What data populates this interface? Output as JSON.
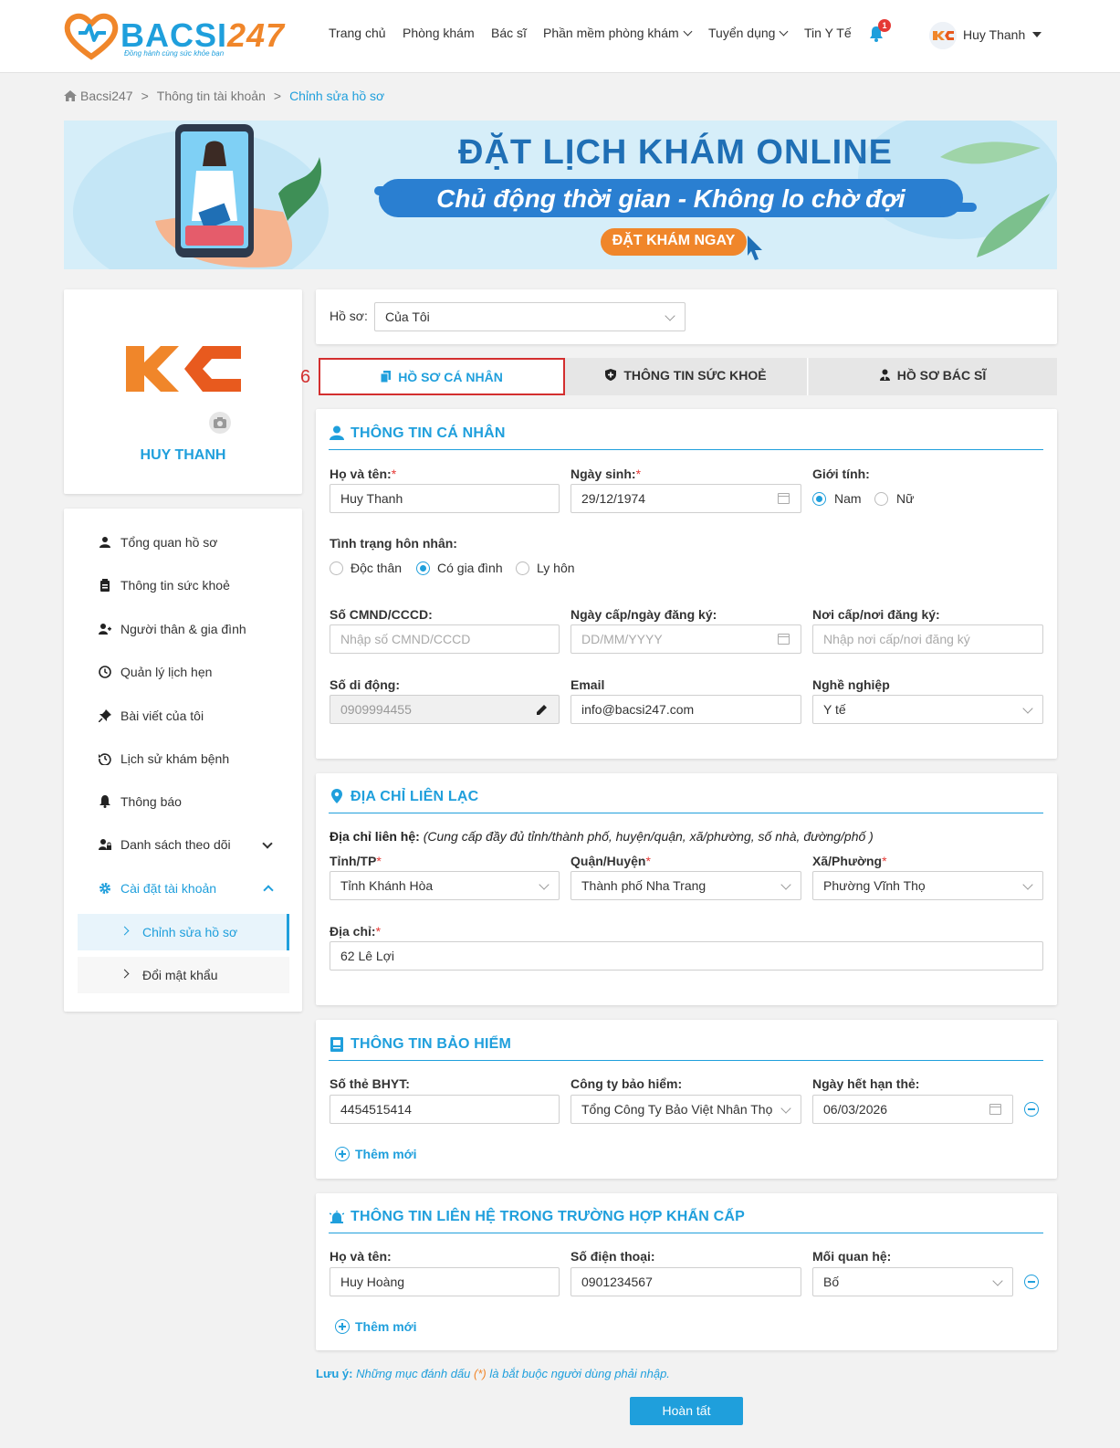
{
  "header": {
    "logo_text": "BACSI",
    "logo_num": "247",
    "logo_tagline": "Đồng hành cùng sức khỏe bạn",
    "nav": [
      "Trang chủ",
      "Phòng khám",
      "Bác sĩ",
      "Phần mềm phòng khám",
      "Tuyển dụng",
      "Tin Y Tế"
    ],
    "notification_count": "1",
    "user_name": "Huy Thanh"
  },
  "breadcrumb": [
    "Bacsi247",
    "Thông tin tài khoản",
    "Chỉnh sửa hồ sơ"
  ],
  "banner": {
    "title": "ĐẶT LỊCH KHÁM ONLINE",
    "subtitle": "Chủ động thời gian - Không lo chờ đợi",
    "cta": "ĐẶT KHÁM NGAY"
  },
  "profile": {
    "avatar_text": "KC",
    "name": "HUY THANH"
  },
  "sidebar": {
    "items": [
      "Tổng quan hồ sơ",
      "Thông tin sức khoẻ",
      "Người thân & gia đình",
      "Quản lý lịch hẹn",
      "Bài viết của tôi",
      "Lịch sử khám bệnh",
      "Thông báo",
      "Danh sách theo dõi",
      "Cài đặt tài khoản"
    ],
    "sub_items": [
      "Chỉnh sửa hồ sơ",
      "Đổi mật khẩu"
    ]
  },
  "profile_select": {
    "label": "Hồ sơ:",
    "value": "Của Tôi"
  },
  "annotation_number": "6",
  "tabs": [
    "HỒ SƠ CÁ NHÂN",
    "THÔNG TIN SỨC KHOẺ",
    "HỒ SƠ BÁC SĨ"
  ],
  "personal": {
    "title": "THÔNG TIN CÁ NHÂN",
    "name_label": "Họ và tên:",
    "name_value": "Huy Thanh",
    "dob_label": "Ngày sinh:",
    "dob_value": "29/12/1974",
    "gender_label": "Giới tính:",
    "gender_options": [
      "Nam",
      "Nữ"
    ],
    "marital_label": "Tình trạng hôn nhân:",
    "marital_options": [
      "Độc thân",
      "Có gia đình",
      "Ly hôn"
    ],
    "id_label": "Số CMND/CCCD:",
    "id_placeholder": "Nhập số CMND/CCCD",
    "issue_date_label": "Ngày cấp/ngày đăng ký:",
    "issue_date_placeholder": "DD/MM/YYYY",
    "issue_place_label": "Nơi cấp/nơi đăng ký:",
    "issue_place_placeholder": "Nhập nơi cấp/nơi đăng ký",
    "phone_label": "Số di động:",
    "phone_value": "0909994455",
    "email_label": "Email",
    "email_value": "info@bacsi247.com",
    "job_label": "Nghề nghiệp",
    "job_value": "Y tế"
  },
  "address": {
    "title": "ĐỊA CHỈ LIÊN LẠC",
    "hint_label": "Địa chỉ liên hệ:",
    "hint_text": "(Cung cấp đầy đủ tỉnh/thành phố, huyện/quận, xã/phường, số nhà, đường/phố )",
    "province_label": "Tỉnh/TP",
    "province_value": "Tỉnh Khánh Hòa",
    "district_label": "Quận/Huyện",
    "district_value": "Thành phố Nha Trang",
    "ward_label": "Xã/Phường",
    "ward_value": "Phường Vĩnh Thọ",
    "street_label": "Địa chỉ:",
    "street_value": "62 Lê Lợi"
  },
  "insurance": {
    "title": "THÔNG TIN BẢO HIỂM",
    "card_label": "Số thẻ BHYT:",
    "card_value": "4454515414",
    "company_label": "Công ty bảo hiểm:",
    "company_value": "Tổng Công Ty Bảo Việt Nhân Thọ",
    "expiry_label": "Ngày hết hạn thẻ:",
    "expiry_value": "06/03/2026",
    "add_label": "Thêm mới"
  },
  "emergency": {
    "title": "THÔNG TIN LIÊN HỆ TRONG TRƯỜNG HỢP KHẨN CẤP",
    "name_label": "Họ và tên:",
    "name_value": "Huy Hoàng",
    "phone_label": "Số điện thoại:",
    "phone_value": "0901234567",
    "relation_label": "Mối quan hệ:",
    "relation_value": "Bố",
    "add_label": "Thêm mới"
  },
  "note": {
    "prefix": "Lưu ý:",
    "text_a": "Những mục đánh dấu",
    "mark": "(*)",
    "text_b": "là bắt buộc người dùng phải nhập."
  },
  "submit_label": "Hoàn tất",
  "colors": {
    "primary": "#1f9fdc",
    "accent": "#f0862a",
    "required": "#e53935"
  }
}
